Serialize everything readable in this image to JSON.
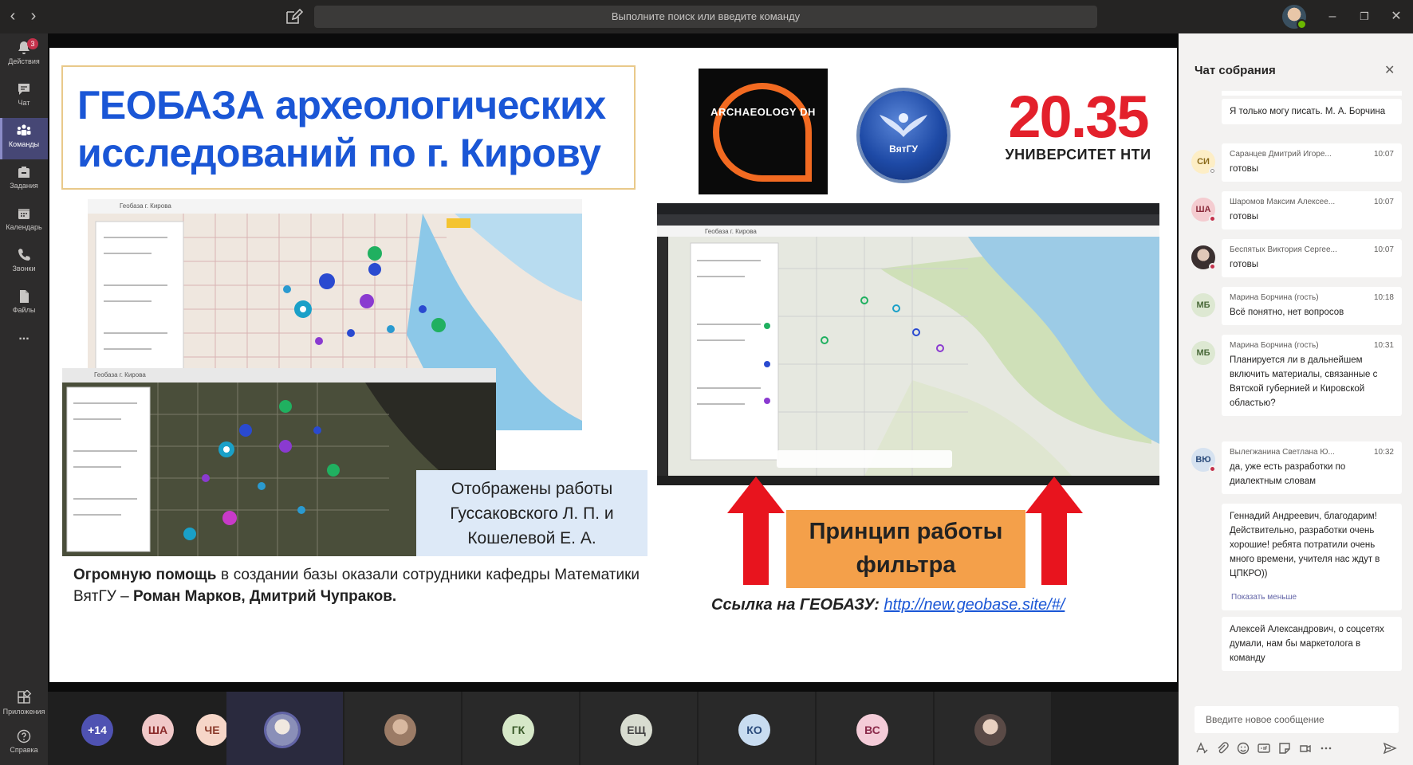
{
  "window": {
    "search_placeholder": "Выполните поиск или введите команду",
    "nav_back": "‹",
    "nav_forward": "›",
    "minimize": "–",
    "maximize": "❐",
    "close": "✕"
  },
  "rail": {
    "items": [
      {
        "label": "Действия",
        "badge": "3"
      },
      {
        "label": "Чат"
      },
      {
        "label": "Команды"
      },
      {
        "label": "Задания"
      },
      {
        "label": "Календарь"
      },
      {
        "label": "Звонки"
      },
      {
        "label": "Файлы"
      },
      {
        "label": "..."
      }
    ],
    "bottom_items": [
      {
        "label": "Приложения"
      },
      {
        "label": "Справка"
      }
    ]
  },
  "slide": {
    "title": "ГЕОБАЗА археологических исследований по г. Кирову",
    "logo_archaeology": "ARCHAEOLOGY DH",
    "logo_vyatgu": "ВятГУ",
    "logo_nti_number": "20.35",
    "logo_nti_text": "УНИВЕРСИТЕТ НТИ",
    "map_header": "Геобаза г. Кирова",
    "caption": "Отображены работы Гуссаковского Л. П. и Кошелевой Е. А.",
    "credit_bold1": "Огромную помощь",
    "credit_text1": " в создании базы оказали сотрудники кафедры Математики ВятГУ – ",
    "credit_bold2": "Роман Марков, Дмитрий Чупраков.",
    "filter_label": "Принцип работы фильтра",
    "link_label": "Ссылка на ГЕОБАЗУ: ",
    "link_url": "http://new.geobase.site/#/"
  },
  "participants": [
    {
      "initials": "+14",
      "color": "#4f52b2",
      "text_color": "#ffffff"
    },
    {
      "initials": "ША",
      "color": "#f0c8c8",
      "text_color": "#8a2a2a"
    },
    {
      "initials": "ЧЕ",
      "color": "#f6d6c8",
      "text_color": "#8a3a2a"
    },
    {
      "initials": "",
      "color": "#8a8fb8"
    },
    {
      "initials": "",
      "color": "#9b7b66"
    },
    {
      "initials": "ГК",
      "color": "#d6e8c8",
      "text_color": "#3a5a2a"
    },
    {
      "initials": "ЕЩ",
      "color": "#d8dcd0",
      "text_color": "#444444"
    },
    {
      "initials": "КО",
      "color": "#c8dcf0",
      "text_color": "#2a4a7a"
    },
    {
      "initials": "ВС",
      "color": "#f4ccd8",
      "text_color": "#8a2a4a"
    },
    {
      "initials": "",
      "color": "#5a4a46"
    }
  ],
  "chat": {
    "title": "Чат собрания",
    "close_icon": "✕",
    "messages": [
      {
        "text": "Я только могу писать. М. А. Борчина"
      },
      {
        "initials": "СИ",
        "name": "Саранцев Дмитрий Игоре...",
        "time": "10:07",
        "text": "готовы"
      },
      {
        "initials": "ША",
        "name": "Шаромов Максим Алексее...",
        "time": "10:07",
        "text": "готовы"
      },
      {
        "initials": "",
        "name": "Беспятых Виктория Сергее...",
        "time": "10:07",
        "text": "готовы"
      },
      {
        "initials": "МБ",
        "name": "Марина Борчина (гость)",
        "time": "10:18",
        "text": "Всё понятно, нет вопросов"
      },
      {
        "initials": "МБ",
        "name": "Марина Борчина (гость)",
        "time": "10:31",
        "text": "Планируется ли в дальнейшем включить материалы, связанные с Вятской губернией и Кировской областью?"
      },
      {
        "initials": "ВЮ",
        "name": "Вылегжанина Светлана Ю...",
        "time": "10:32",
        "text": "да, уже есть разработки по диалектным словам"
      },
      {
        "text": "Геннадий Андреевич, благодарим! Действительно, разработки очень хорошие! ребята потратили очень много времени, учителя нас ждут в ЦПКРО))"
      },
      {
        "text": "Алексей Александрович, о соцсетях думали, нам бы маркетолога в команду"
      }
    ],
    "show_less": "Показать меньше",
    "compose_placeholder": "Введите новое сообщение"
  }
}
